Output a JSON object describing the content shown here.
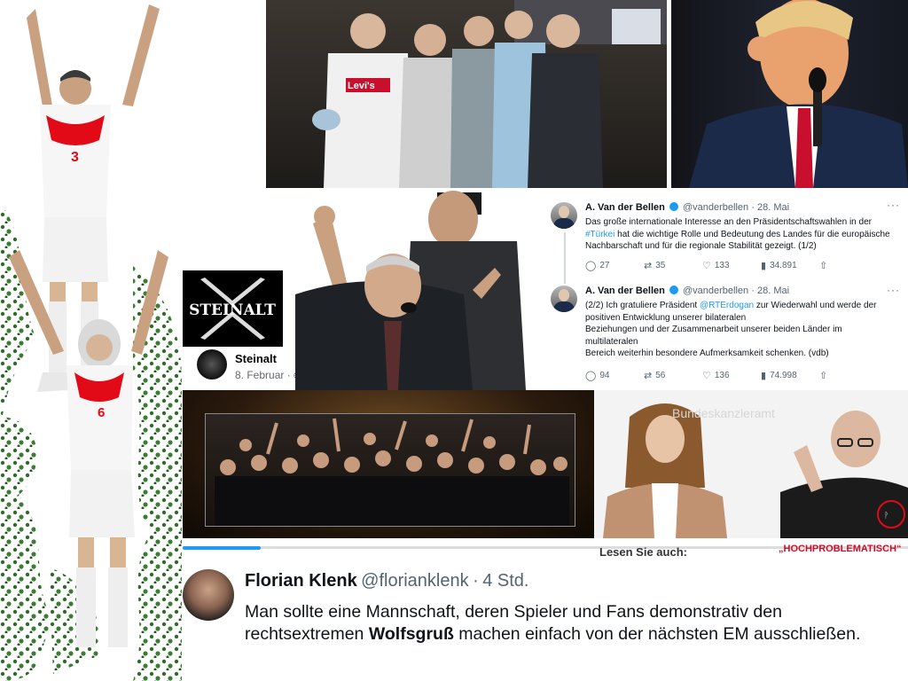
{
  "top_photos": {
    "group_shirt_text": "Levi's"
  },
  "steinalt": {
    "logo_text": "STEINALT",
    "page_name": "Steinalt",
    "date": "8. Februar",
    "visibility_icon": "globe-icon"
  },
  "tweets": [
    {
      "name": "A. Van der Bellen",
      "handle": "@vanderbellen",
      "sep": "·",
      "date": "28. Mai",
      "text_before": "Das große internationale Interesse an den Präsidentschaftswahlen in der ",
      "link": "#Türkei",
      "text_after": " hat die wichtige Rolle und Bedeutung des Landes für die europäische Nachbarschaft und für die regionale Stabilität gezeigt. (1/2)",
      "replies": "27",
      "retweets": "35",
      "likes": "133",
      "views": "34.891"
    },
    {
      "name": "A. Van der Bellen",
      "handle": "@vanderbellen",
      "sep": "·",
      "date": "28. Mai",
      "text_before": "(2/2) Ich gratuliere Präsident ",
      "link": "@RTErdogan",
      "text_after": " zur Wiederwahl und werde der positiven Entwicklung unserer bilateralen",
      "line2": "Beziehungen und der Zusammenarbeit unserer beiden Länder im",
      "line3": "multilateralen",
      "line4": "Bereich weiterhin besondere Aufmerksamkeit schenken. (vdb)",
      "replies": "94",
      "retweets": "56",
      "likes": "136",
      "views": "74.998"
    }
  ],
  "kanzleramt": {
    "watermark": "Bundeskanzleramt",
    "lesen_label": "Lesen Sie auch:",
    "headline": "„HOCHPROBLEMATISCH“"
  },
  "florian_tweet": {
    "name": "Florian Klenk",
    "handle": "@florianklenk",
    "sep": "·",
    "time": "4 Std.",
    "text_before": "Man sollte eine Mannschaft, deren Spieler und Fans demonstrativ den rechtsextremen ",
    "bold": "Wolfsgruß",
    "text_after": " machen einfach von der nächsten EM ausschließen."
  },
  "colors": {
    "twitter_blue": "#1d9bf0",
    "headline_red": "#c8102e",
    "turkey_red": "#e30a17",
    "grass_green": "#2f6b2a"
  }
}
